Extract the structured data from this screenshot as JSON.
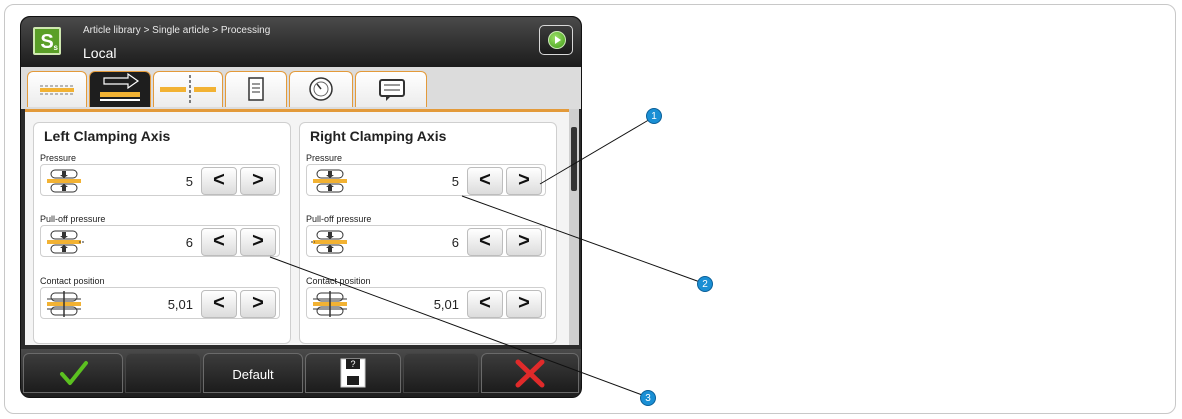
{
  "header": {
    "breadcrumb": "Article library > Single article > Processing",
    "subtitle": "Local",
    "logo_letter": "S"
  },
  "tabs": [
    {
      "name": "tab-clamping-overview",
      "icon": "clamp-overview-icon"
    },
    {
      "name": "tab-clamping-axes",
      "icon": "arrow-right-icon",
      "active": true
    },
    {
      "name": "tab-cut-position",
      "icon": "cut-position-icon"
    },
    {
      "name": "tab-list",
      "icon": "list-icon"
    },
    {
      "name": "tab-speed",
      "icon": "gauge-icon"
    },
    {
      "name": "tab-message",
      "icon": "message-icon"
    }
  ],
  "left_panel": {
    "title": "Left Clamping Axis",
    "pressure_label": "Pressure",
    "pressure_value": "5",
    "pulloff_label": "Pull-off pressure",
    "pulloff_value": "6",
    "contact_label": "Contact position",
    "contact_value": "5,01"
  },
  "right_panel": {
    "title": "Right Clamping Axis",
    "pressure_label": "Pressure",
    "pressure_value": "5",
    "pulloff_label": "Pull-off pressure",
    "pulloff_value": "6",
    "contact_label": "Contact position",
    "contact_value": "5,01"
  },
  "buttons": {
    "decrement": "<",
    "increment": ">"
  },
  "bottom": {
    "default_label": "Default",
    "save_question": "?"
  },
  "callouts": [
    "1",
    "2",
    "3"
  ],
  "colors": {
    "accent": "#e39a3a",
    "confirm": "#5bc020",
    "cancel": "#e02a2a",
    "callout": "#1a8fd4"
  }
}
